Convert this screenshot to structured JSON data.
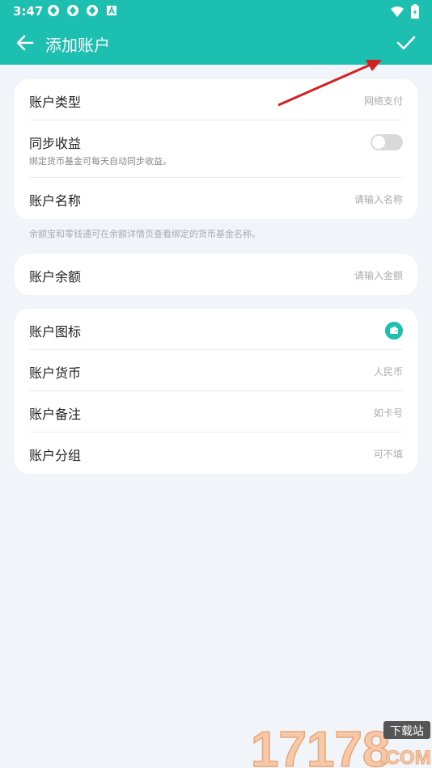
{
  "statusbar": {
    "time": "3:47",
    "notification_icons": [
      "sync-icon",
      "sync-icon",
      "sync-icon",
      "a-icon"
    ],
    "right_icons": [
      "wifi-icon",
      "battery-icon"
    ]
  },
  "toolbar": {
    "title": "添加账户",
    "back_icon": "arrow-left-icon",
    "confirm_icon": "check-icon"
  },
  "form": {
    "group1": [
      {
        "label": "账户类型",
        "value": "网络支付"
      },
      {
        "label": "同步收益",
        "sub": "绑定货币基金可每天自动同步收益。",
        "toggle": false
      },
      {
        "label": "账户名称",
        "placeholder": "请输入名称"
      }
    ],
    "hint": "余额宝和零钱通可在余额详情页查看绑定的货币基金名称。",
    "group2": [
      {
        "label": "账户余额",
        "placeholder": "请输入金额"
      }
    ],
    "group3": [
      {
        "label": "账户图标",
        "icon": "wallet-icon"
      },
      {
        "label": "账户货币",
        "value": "人民币"
      },
      {
        "label": "账户备注",
        "placeholder": "如卡号"
      },
      {
        "label": "账户分组",
        "placeholder": "可不填"
      }
    ]
  },
  "watermark": {
    "text": "17178",
    "badge": "下载站",
    "suffix": ".COM"
  },
  "colors": {
    "primary": "#1dbfb0",
    "background": "#f1f4f9",
    "arrow": "#d32020"
  }
}
